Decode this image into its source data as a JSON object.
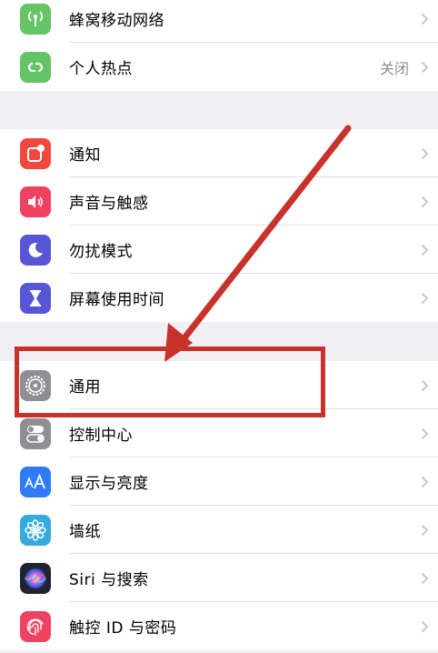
{
  "groups": [
    {
      "items": [
        {
          "label": "蜂窝移动网络",
          "icon": "antenna-icon",
          "color": "#65c466",
          "value": ""
        },
        {
          "label": "个人热点",
          "icon": "hotspot-chain-icon",
          "color": "#65c466",
          "value": "关闭"
        }
      ]
    },
    {
      "items": [
        {
          "label": "通知",
          "icon": "notification-icon",
          "color": "#f0483e",
          "value": ""
        },
        {
          "label": "声音与触感",
          "icon": "speaker-icon",
          "color": "#ef4160",
          "value": ""
        },
        {
          "label": "勿扰模式",
          "icon": "moon-icon",
          "color": "#5856d6",
          "value": ""
        },
        {
          "label": "屏幕使用时间",
          "icon": "hourglass-icon",
          "color": "#5856d6",
          "value": ""
        }
      ]
    },
    {
      "items": [
        {
          "label": "通用",
          "icon": "gear-icon",
          "color": "#8e8e93",
          "value": ""
        },
        {
          "label": "控制中心",
          "icon": "toggles-icon",
          "color": "#8e8e93",
          "value": ""
        },
        {
          "label": "显示与亮度",
          "icon": "text-size-icon",
          "color": "#2f7cf6",
          "value": ""
        },
        {
          "label": "墙纸",
          "icon": "flower-icon",
          "color": "#36aadc",
          "value": ""
        },
        {
          "label": "Siri 与搜索",
          "icon": "siri-icon",
          "color": "#222235",
          "value": ""
        },
        {
          "label": "触控 ID 与密码",
          "icon": "fingerprint-icon",
          "color": "#ef4160",
          "value": ""
        }
      ]
    }
  ],
  "annotation": {
    "color": "#c8322b",
    "highlighted": "通用"
  }
}
